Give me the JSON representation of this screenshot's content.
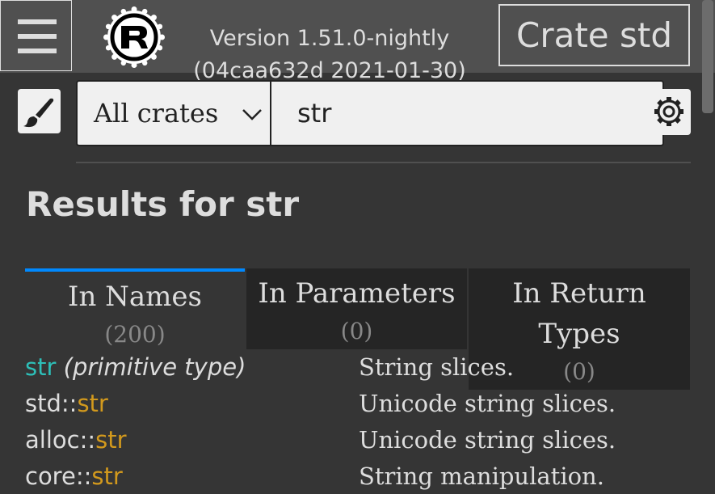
{
  "header": {
    "version_line1": "Version 1.51.0-nightly",
    "version_line2": "(04caa632d 2021-01-30)",
    "crate_button": "Crate std"
  },
  "search": {
    "crate_filter": "All crates",
    "query": "str"
  },
  "results": {
    "title": "Results for str",
    "tabs": [
      {
        "label": "In Names",
        "count": "(200)"
      },
      {
        "label": "In Parameters",
        "count": "(0)"
      },
      {
        "label_line1": "In Return",
        "label_line2": "Types",
        "count": "(0)"
      }
    ],
    "rows": [
      {
        "prefix": "",
        "name": "str",
        "suffix": " (primitive type)",
        "desc": "String slices."
      },
      {
        "prefix": "std::",
        "name": "str",
        "suffix": "",
        "desc": "Unicode string slices."
      },
      {
        "prefix": "alloc::",
        "name": "str",
        "suffix": "",
        "desc": "Unicode string slices."
      },
      {
        "prefix": "core::",
        "name": "str",
        "suffix": "",
        "desc": "String manipulation."
      }
    ]
  },
  "colors": {
    "accent": "#0089ff",
    "primitive": "#2dbfb8",
    "module": "#d2991d",
    "background": "#353535",
    "topbar": "#505050"
  }
}
